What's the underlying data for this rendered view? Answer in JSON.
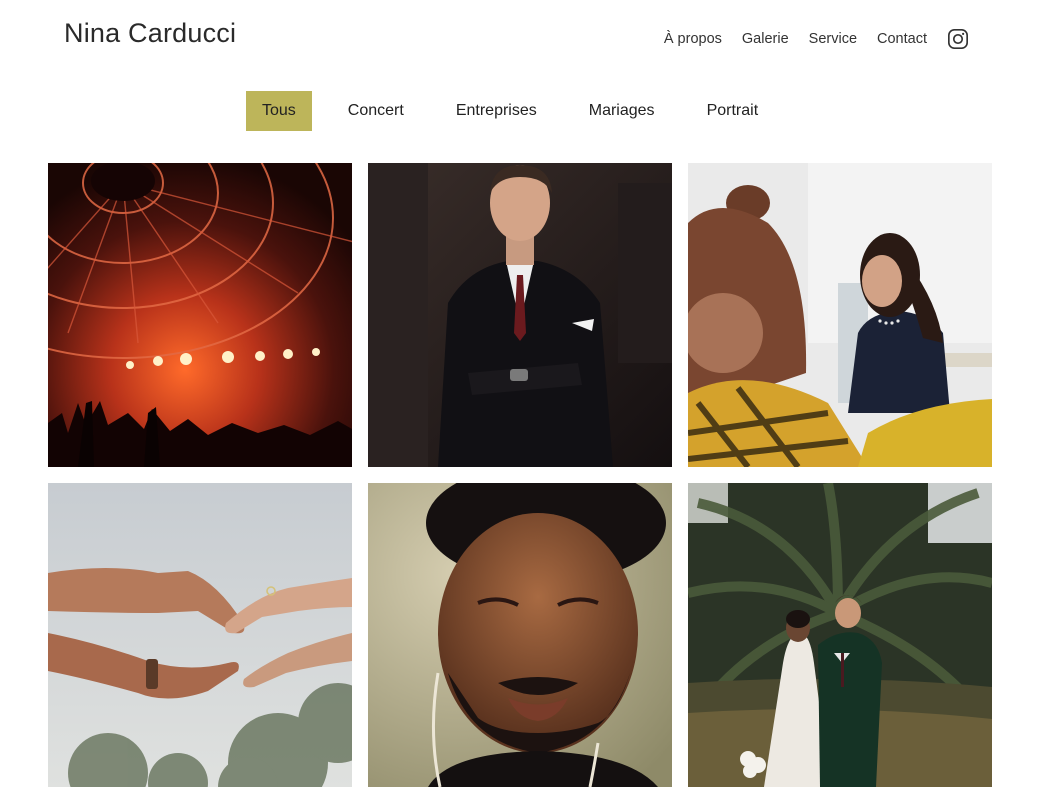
{
  "brand": {
    "name": "Nina Carducci"
  },
  "nav": {
    "items": [
      "À propos",
      "Galerie",
      "Service",
      "Contact"
    ],
    "instagram_icon": "instagram-icon"
  },
  "filters": {
    "items": [
      "Tous",
      "Concert",
      "Entreprises",
      "Mariages",
      "Portrait"
    ],
    "active": "Tous"
  },
  "gallery": {
    "photos": [
      {
        "name": "concert-stage-lights-photo",
        "category": "Concert"
      },
      {
        "name": "businessman-suit-photo",
        "category": "Entreprises"
      },
      {
        "name": "office-meeting-laughing-photo",
        "category": "Entreprises"
      },
      {
        "name": "hands-reaching-ring-photo",
        "category": "Mariages"
      },
      {
        "name": "man-portrait-closeup-photo",
        "category": "Portrait"
      },
      {
        "name": "wedding-couple-palm-photo",
        "category": "Mariages"
      }
    ]
  },
  "colors": {
    "accent": "#bdb55a",
    "text": "#222222",
    "background": "#ffffff"
  }
}
